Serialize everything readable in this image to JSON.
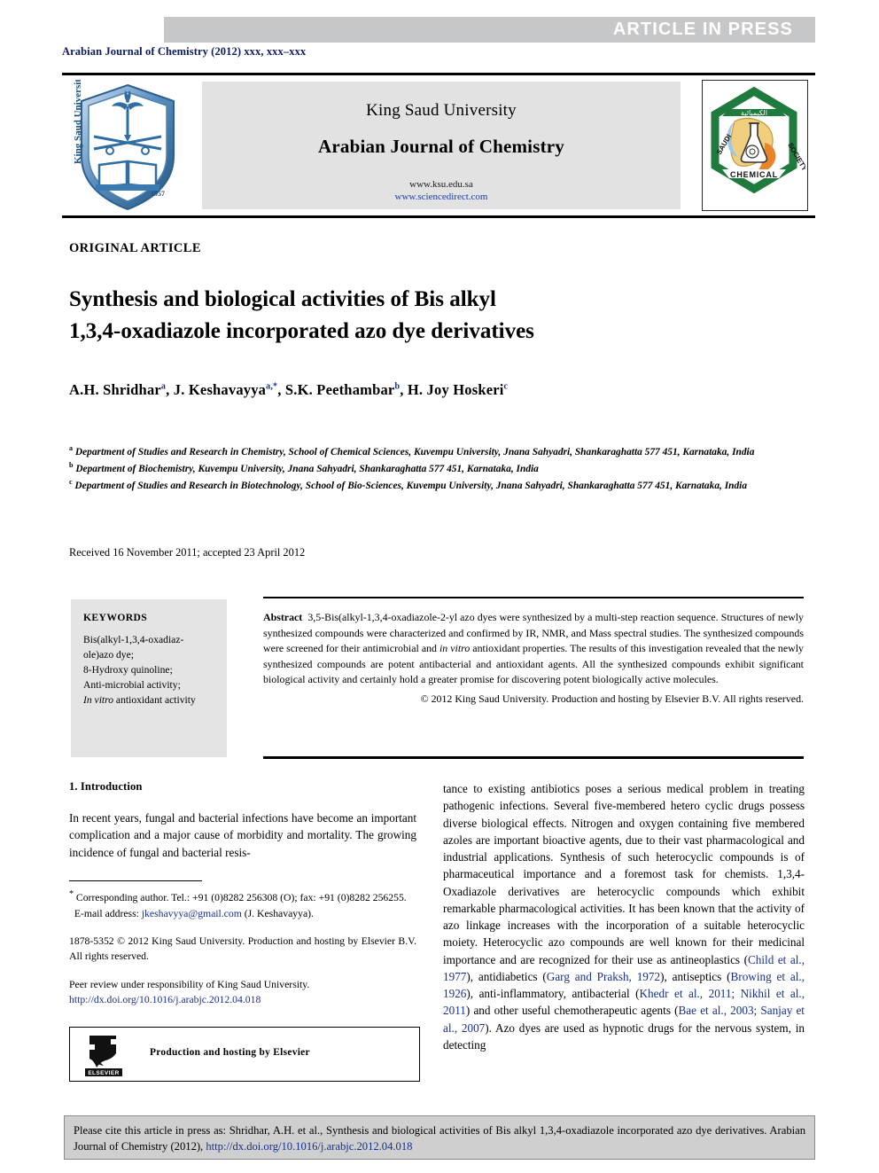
{
  "banner": {
    "text": "ARTICLE  IN  PRESS"
  },
  "masthead": {
    "line": "Arabian Journal of Chemistry (2012) xxx, xxx–xxx"
  },
  "journal_header": {
    "university": "King Saud University",
    "journal_title": "Arabian Journal of Chemistry",
    "url_primary": "www.ksu.edu.sa",
    "url_secondary": "www.sciencedirect.com",
    "left_logo_name": "king-saud-university-shield-logo",
    "left_logo_text_left": "King Saud University",
    "left_logo_year": "1957",
    "right_logo_name": "saudi-chemical-society-logo",
    "right_logo_text_bottom": "CHEMICAL",
    "right_logo_text_left": "SAUDI",
    "right_logo_text_right": "SOCIETY"
  },
  "article": {
    "type_label": "ORIGINAL ARTICLE",
    "title_line1": "Synthesis and biological activities of Bis alkyl",
    "title_line2": "1,3,4-oxadiazole incorporated azo dye derivatives",
    "authors": [
      {
        "name": "A.H. Shridhar",
        "sup": "a",
        "sep": ", "
      },
      {
        "name": "J. Keshavayya",
        "sup": "a,*",
        "sep": ", "
      },
      {
        "name": "S.K. Peethambar",
        "sup": "b",
        "sep": ", "
      },
      {
        "name": "H. Joy Hoskeri",
        "sup": "c",
        "sep": ""
      }
    ],
    "affiliations": [
      {
        "sup": "a",
        "text": "Department of Studies and Research in Chemistry, School of Chemical Sciences, Kuvempu University, Jnana Sahyadri, Shankaraghatta 577 451, Karnataka, India"
      },
      {
        "sup": "b",
        "text": "Department of Biochemistry, Kuvempu University, Jnana Sahyadri, Shankaraghatta 577 451, Karnataka, India"
      },
      {
        "sup": "c",
        "text": "Department of Studies and Research in Biotechnology, School of Bio-Sciences, Kuvempu University, Jnana Sahyadri, Shankaraghatta 577 451, Karnataka, India"
      }
    ],
    "dates": "Received 16 November 2011; accepted 23 April 2012"
  },
  "keywords": {
    "heading": "KEYWORDS",
    "items": [
      "Bis(alkyl-1,3,4-oxadiaz-ole)azo dye;",
      "8-Hydroxy quinoline;",
      "Anti-microbial activity;",
      "In vitro antioxidant activity"
    ],
    "italic_prefix_last": "In vitro",
    "last_remainder": " antioxidant activity"
  },
  "abstract": {
    "label": "Abstract",
    "text_part1": "3,5-Bis(alkyl-1,3,4-oxadiazole-2-yl azo dyes were synthesized by a multi-step reaction sequence. Structures of newly synthesized compounds were characterized and confirmed by IR, NMR, and Mass spectral studies. The synthesized compounds were screened for their antimicrobial and ",
    "italic_phrase": "in vitro",
    "text_part2": " antioxidant properties. The results of this investigation revealed that the newly synthesized compounds are potent antibacterial and antioxidant agents. All the synthesized compounds exhibit significant biological activity and certainly hold a greater promise for discovering potent biologically active molecules.",
    "copyright": "© 2012 King Saud University. Production and hosting by Elsevier B.V. All rights reserved."
  },
  "body": {
    "section_heading": "1. Introduction",
    "left_paragraph": "In recent years, fungal and bacterial infections have become an important complication and a major cause of morbidity and mortality. The growing incidence of fungal and bacterial resis-",
    "right_paragraph_part1": "tance to existing antibiotics poses a serious medical problem in treating pathogenic infections. Several five-membered hetero cyclic drugs possess diverse biological effects. Nitrogen and oxygen containing five membered azoles are important bioactive agents, due to their vast pharmacological and industrial applications. Synthesis of such heterocyclic compounds is of pharmaceutical importance and a foremost task for chemists. 1,3,4-Oxadiazole derivatives are heterocyclic compounds which exhibit remarkable pharmacological activities. It has been known that the activity of azo linkage increases with the incorporation of a suitable heterocyclic moiety. Heterocyclic azo compounds are well known for their medicinal importance and are recognized for their use as antineoplastics (",
    "ref1": "Child et al., 1977",
    "right_paragraph_part2": "), antidiabetics (",
    "ref2": "Garg and Praksh, 1972",
    "right_paragraph_part3": "), antiseptics (",
    "ref3": "Browing et al., 1926",
    "right_paragraph_part4": "), anti-inflammatory, antibacterial (",
    "ref4": "Khedr et al., 2011; Nikhil et al., 2011",
    "right_paragraph_part5": ") and other useful chemotherapeutic agents (",
    "ref5": "Bae et al., 2003; Sanjay et al., 2007",
    "right_paragraph_part6": "). Azo dyes are used as hypnotic drugs for the nervous system, in detecting"
  },
  "footnotes": {
    "corresponding": "Corresponding author. Tel.: +91 (0)8282 256308 (O); fax: +91 (0)8282 256255.",
    "email_label": "E-mail address:",
    "email": "jkeshavyya@gmail.com",
    "email_owner": "(J. Keshavayya).",
    "issn_line": "1878-5352 © 2012 King Saud University. Production and hosting by Elsevier B.V. All rights reserved.",
    "peer_review": "Peer review under responsibility of King Saud University.",
    "doi": "http://dx.doi.org/10.1016/j.arabjc.2012.04.018"
  },
  "elsevier_box": {
    "text": "Production and hosting by Elsevier",
    "logo_label": "ELSEVIER"
  },
  "citation_footer": {
    "text_part1": "Please cite this article in press as: Shridhar, A.H. et al., Synthesis and biological activities of Bis alkyl 1,3,4-oxadiazole incorporated azo dye derivatives. Arabian Journal of Chemistry (2012), ",
    "doi": "http://dx.doi.org/10.1016/j.arabjc.2012.04.018"
  },
  "colors": {
    "banner_bg": "#c6c7c9",
    "banner_text": "#ffffff",
    "masthead_navy": "#0d1b5e",
    "link_blue": "#16308e",
    "panel_gray": "#e2e2e2",
    "keyword_gray": "#e4e4e4",
    "footer_gray": "#cfcfcf"
  }
}
